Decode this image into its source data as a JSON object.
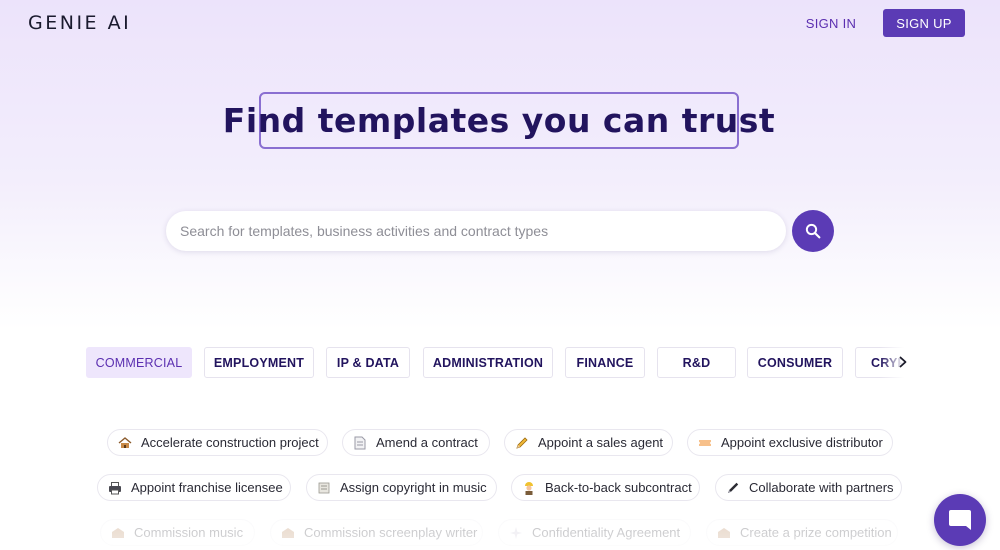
{
  "header": {
    "logo": "GENIE AI",
    "sign_in": "SIGN IN",
    "sign_up": "SIGN UP"
  },
  "hero": {
    "title": "Find templates you can trust"
  },
  "search": {
    "placeholder": "Search for templates, business activities and contract types",
    "value": "",
    "icon": "search-icon"
  },
  "tabs": [
    {
      "label": "COMMERCIAL",
      "active": true
    },
    {
      "label": "EMPLOYMENT",
      "active": false
    },
    {
      "label": "IP & DATA",
      "active": false
    },
    {
      "label": "ADMINISTRATION",
      "active": false
    },
    {
      "label": "FINANCE",
      "active": false
    },
    {
      "label": "R&D",
      "active": false
    },
    {
      "label": "CONSUMER",
      "active": false
    },
    {
      "label": "CRYPTO",
      "active": false
    }
  ],
  "chips": [
    {
      "label": "Accelerate construction project",
      "icon": "construction-house-icon"
    },
    {
      "label": "Amend a contract",
      "icon": "document-icon"
    },
    {
      "label": "Appoint a sales agent",
      "icon": "pencil-icon"
    },
    {
      "label": "Appoint exclusive distributor",
      "icon": "ticket-icon"
    },
    {
      "label": "Appoint franchise licensee",
      "icon": "printer-icon"
    },
    {
      "label": "Assign copyright in music",
      "icon": "scroll-icon"
    },
    {
      "label": "Back-to-back subcontract",
      "icon": "worker-icon"
    },
    {
      "label": "Collaborate with partners",
      "icon": "pen-icon"
    },
    {
      "label": "Commission music",
      "icon": "building-icon"
    },
    {
      "label": "Commission screenplay writer",
      "icon": "building-icon"
    },
    {
      "label": "Confidentiality Agreement",
      "icon": "sparkle-icon"
    },
    {
      "label": "Create a prize competition",
      "icon": "building-icon"
    }
  ],
  "chat": {
    "icon": "chat-bubble-icon"
  },
  "colors": {
    "brand": "#5b3bb5",
    "hero_text": "#22145e",
    "active_tab_bg": "#eee6fc"
  }
}
